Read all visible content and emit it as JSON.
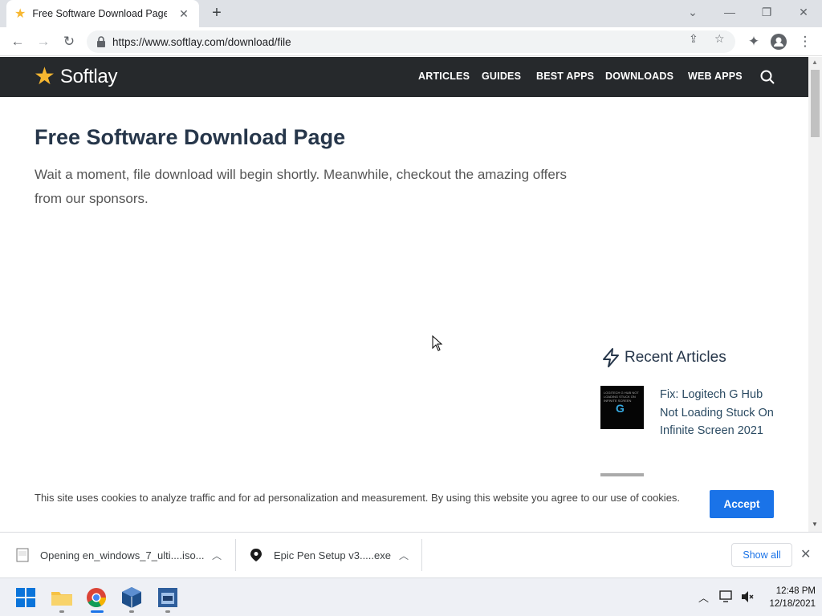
{
  "browser": {
    "tab_title": "Free Software Download Page - Softlay",
    "tab_close": "✕",
    "new_tab": "+",
    "url": "https://www.softlay.com/download/file"
  },
  "site": {
    "logo_text": "Softlay",
    "nav": [
      "ARTICLES",
      "GUIDES",
      "BEST APPS",
      "DOWNLOADS",
      "WEB APPS"
    ]
  },
  "main": {
    "title": "Free Software Download Page",
    "intro": "Wait a moment, file download will begin shortly. Meanwhile, checkout the amazing offers from our sponsors."
  },
  "sidebar": {
    "recent_title": "Recent Articles",
    "articles": [
      {
        "title": "Fix: Logitech G Hub Not Loading Stuck On Infinite Screen 2021",
        "thumb_caption": "LOGITECH G HUB NOT LOADING STUCK ON INFINITE SCREEN"
      }
    ]
  },
  "cookie": {
    "text": "This site uses cookies to analyze traffic and for ad personalization and measurement. By using this website you agree to our use of cookies.",
    "accept_label": "Accept"
  },
  "downloads": {
    "items": [
      {
        "name": "Opening en_windows_7_ulti....iso..."
      },
      {
        "name": "Epic Pen Setup v3.....exe"
      }
    ],
    "show_all_label": "Show all"
  },
  "taskbar": {
    "time": "12:48 PM",
    "date": "12/18/2021"
  },
  "colors": {
    "header_bg": "#26292c",
    "accent": "#1a73e8",
    "logo_star": "#f7b731",
    "title_text": "#26364a"
  }
}
